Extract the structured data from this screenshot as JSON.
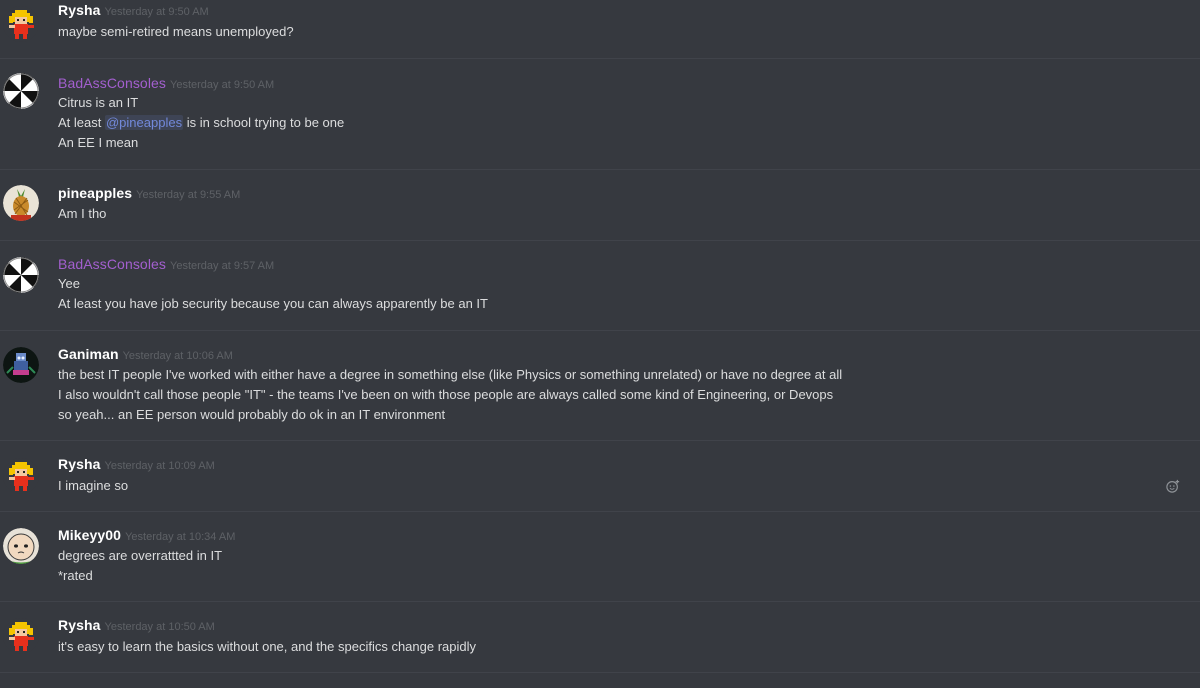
{
  "messages": [
    {
      "author": "Rysha",
      "timestamp": "Yesterday at 9:50 AM",
      "lines": [
        "maybe semi-retired means unemployed?"
      ]
    },
    {
      "author": "BadAssConsoles",
      "timestamp": "Yesterday at 9:50 AM",
      "lines": [
        "Citrus is an IT",
        "is in school trying to be one",
        "An EE I mean"
      ],
      "line2_prefix": "At least",
      "mention": "@pineapples"
    },
    {
      "author": "pineapples",
      "timestamp": "Yesterday at 9:55 AM",
      "lines": [
        "Am I tho"
      ]
    },
    {
      "author": "BadAssConsoles",
      "timestamp": "Yesterday at 9:57 AM",
      "lines": [
        "Yee",
        "At least you have job security because you can always apparently be an IT"
      ]
    },
    {
      "author": "Ganiman",
      "timestamp": "Yesterday at 10:06 AM",
      "lines": [
        "the best IT people I've worked with either have a degree in something else (like Physics or something unrelated) or have no degree at all",
        "I also wouldn't call those people \"IT\" - the teams I've been on with those people are always called some kind of Engineering, or Devops",
        "so yeah... an EE person would probably do ok in an IT environment"
      ]
    },
    {
      "author": "Rysha",
      "timestamp": "Yesterday at 10:09 AM",
      "lines": [
        "I imagine so"
      ]
    },
    {
      "author": "Mikeyy00",
      "timestamp": "Yesterday at 10:34 AM",
      "lines": [
        "degrees are overrattted in IT",
        "*rated"
      ]
    },
    {
      "author": "Rysha",
      "timestamp": "Yesterday at 10:50 AM",
      "lines": [
        "it's easy to learn the basics without one, and the specifics change rapidly"
      ]
    }
  ],
  "colors": {
    "background": "#36393f",
    "username_default": "#ffffff",
    "username_purple": "#a35fcf",
    "text": "#dcddde",
    "timestamp": "#5e6166",
    "mention": "#7289da"
  },
  "icons": {
    "reaction": "add-reaction-icon"
  }
}
